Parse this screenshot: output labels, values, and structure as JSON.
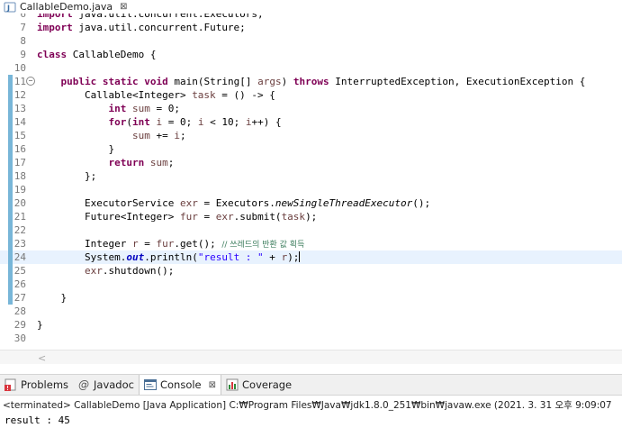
{
  "editor_tab": {
    "title": "CallableDemo.java",
    "close_symbol": "⊠"
  },
  "code_lines": [
    {
      "n": "6",
      "t": [
        [
          "kw",
          "import"
        ],
        [
          "",
          " java.util.concurrent.Executors;"
        ]
      ]
    },
    {
      "n": "7",
      "t": [
        [
          "kw",
          "import"
        ],
        [
          "",
          " java.util.concurrent.Future;"
        ]
      ]
    },
    {
      "n": "8",
      "t": []
    },
    {
      "n": "9",
      "t": [
        [
          "kw",
          "class"
        ],
        [
          "",
          " CallableDemo {"
        ]
      ]
    },
    {
      "n": "10",
      "t": []
    },
    {
      "n": "11",
      "t": [
        [
          "",
          "    "
        ],
        [
          "kw",
          "public"
        ],
        [
          "",
          " "
        ],
        [
          "kw",
          "static"
        ],
        [
          "",
          " "
        ],
        [
          "kw",
          "void"
        ],
        [
          "",
          " main(String[] "
        ],
        [
          "loc",
          "args"
        ],
        [
          "",
          ") "
        ],
        [
          "kw",
          "throws"
        ],
        [
          "",
          " InterruptedException, ExecutionException {"
        ]
      ]
    },
    {
      "n": "12",
      "t": [
        [
          "",
          "        Callable<Integer> "
        ],
        [
          "loc",
          "task"
        ],
        [
          "",
          " = () -> {"
        ]
      ]
    },
    {
      "n": "13",
      "t": [
        [
          "",
          "            "
        ],
        [
          "kw",
          "int"
        ],
        [
          "",
          " "
        ],
        [
          "loc",
          "sum"
        ],
        [
          "",
          " = 0;"
        ]
      ]
    },
    {
      "n": "14",
      "t": [
        [
          "",
          "            "
        ],
        [
          "kw",
          "for"
        ],
        [
          "",
          "("
        ],
        [
          "kw",
          "int"
        ],
        [
          "",
          " "
        ],
        [
          "loc",
          "i"
        ],
        [
          "",
          " = 0; "
        ],
        [
          "loc",
          "i"
        ],
        [
          "",
          " < 10; "
        ],
        [
          "loc",
          "i"
        ],
        [
          "",
          "++) {"
        ]
      ]
    },
    {
      "n": "15",
      "t": [
        [
          "",
          "                "
        ],
        [
          "loc",
          "sum"
        ],
        [
          "",
          " += "
        ],
        [
          "loc",
          "i"
        ],
        [
          "",
          ";"
        ]
      ]
    },
    {
      "n": "16",
      "t": [
        [
          "",
          "            }"
        ]
      ]
    },
    {
      "n": "17",
      "t": [
        [
          "",
          "            "
        ],
        [
          "kw",
          "return"
        ],
        [
          "",
          " "
        ],
        [
          "loc",
          "sum"
        ],
        [
          "",
          ";"
        ]
      ]
    },
    {
      "n": "18",
      "t": [
        [
          "",
          "        };"
        ]
      ]
    },
    {
      "n": "19",
      "t": []
    },
    {
      "n": "20",
      "t": [
        [
          "",
          "        ExecutorService "
        ],
        [
          "loc",
          "exr"
        ],
        [
          "",
          " = Executors."
        ],
        [
          "stm",
          "newSingleThreadExecutor"
        ],
        [
          "",
          "();"
        ]
      ]
    },
    {
      "n": "21",
      "t": [
        [
          "",
          "        Future<Integer> "
        ],
        [
          "loc",
          "fur"
        ],
        [
          "",
          " = "
        ],
        [
          "loc",
          "exr"
        ],
        [
          "",
          ".submit("
        ],
        [
          "loc",
          "task"
        ],
        [
          "",
          ");"
        ]
      ]
    },
    {
      "n": "22",
      "t": []
    },
    {
      "n": "23",
      "t": [
        [
          "",
          "        Integer "
        ],
        [
          "loc",
          "r"
        ],
        [
          "",
          " = "
        ],
        [
          "loc",
          "fur"
        ],
        [
          "",
          ".get(); "
        ],
        [
          "com",
          "// 쓰레드의 반환 값 획득"
        ]
      ]
    },
    {
      "n": "24",
      "t": [
        [
          "",
          "        System."
        ],
        [
          "fld",
          "out"
        ],
        [
          "",
          ".println("
        ],
        [
          "str",
          "\"result : \""
        ],
        [
          "",
          " + "
        ],
        [
          "loc",
          "r"
        ],
        [
          "",
          ");"
        ]
      ]
    },
    {
      "n": "25",
      "t": [
        [
          "",
          "        "
        ],
        [
          "loc",
          "exr"
        ],
        [
          "",
          ".shutdown();"
        ]
      ]
    },
    {
      "n": "26",
      "t": []
    },
    {
      "n": "27",
      "t": [
        [
          "",
          "    }"
        ]
      ]
    },
    {
      "n": "28",
      "t": []
    },
    {
      "n": "29",
      "t": [
        [
          "",
          "}"
        ]
      ]
    },
    {
      "n": "30",
      "t": []
    }
  ],
  "current_line": "24",
  "fold_line": "11",
  "fold_symbol": "⊖",
  "scroll_left_symbol": "<",
  "view_tabs": [
    {
      "label": "Problems",
      "icon": "problems-icon"
    },
    {
      "label": "Javadoc",
      "icon": "javadoc-at-icon"
    },
    {
      "label": "Console",
      "icon": "console-icon",
      "active": true
    },
    {
      "label": "Coverage",
      "icon": "coverage-icon"
    }
  ],
  "console": {
    "status_line": "<terminated> CallableDemo [Java Application] C:₩Program Files₩Java₩jdk1.8.0_251₩bin₩javaw.exe  (2021. 3. 31 오후 9:09:07",
    "output": "result : 45"
  },
  "colors": {
    "keyword": "#7f0055",
    "string": "#2a00ff",
    "comment": "#3f7f5f",
    "current_line": "#e8f2fe",
    "quick_diff": "#78b6d8"
  }
}
